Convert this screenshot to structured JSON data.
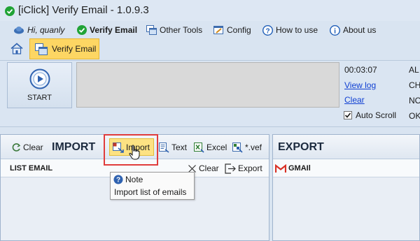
{
  "window": {
    "title": "[iClick] Verify Email - 1.0.9.3"
  },
  "menu": {
    "user": "Hi, quanly",
    "verify_email": "Verify Email",
    "other_tools": "Other Tools",
    "config": "Config",
    "how_to_use": "How to use",
    "about_us": "About us"
  },
  "ribbon": {
    "tab_verify": "Verify Email",
    "start": "START",
    "timer": "00:03:07",
    "view_log": "View log",
    "clear": "Clear",
    "auto_scroll": "Auto Scroll",
    "auto_scroll_checked": true,
    "stats_right": [
      "AL",
      "CH",
      "NO",
      "OK"
    ]
  },
  "import_panel": {
    "clear": "Clear",
    "title": "IMPORT",
    "import": "Import",
    "text": "Text",
    "excel": "Excel",
    "vef": "*.vef",
    "list_title": "LIST EMAIL",
    "list_clear": "Clear",
    "list_export": "Export"
  },
  "export_panel": {
    "title": "EXPORT",
    "gmail": "GMAIl"
  },
  "tooltip": {
    "title": "Note",
    "body": "Import list of emails"
  },
  "colors": {
    "accent_yellow": "#fdd663",
    "highlight_red": "#e03c3c",
    "link_blue": "#0f3fd2",
    "check_green": "#21a336"
  }
}
